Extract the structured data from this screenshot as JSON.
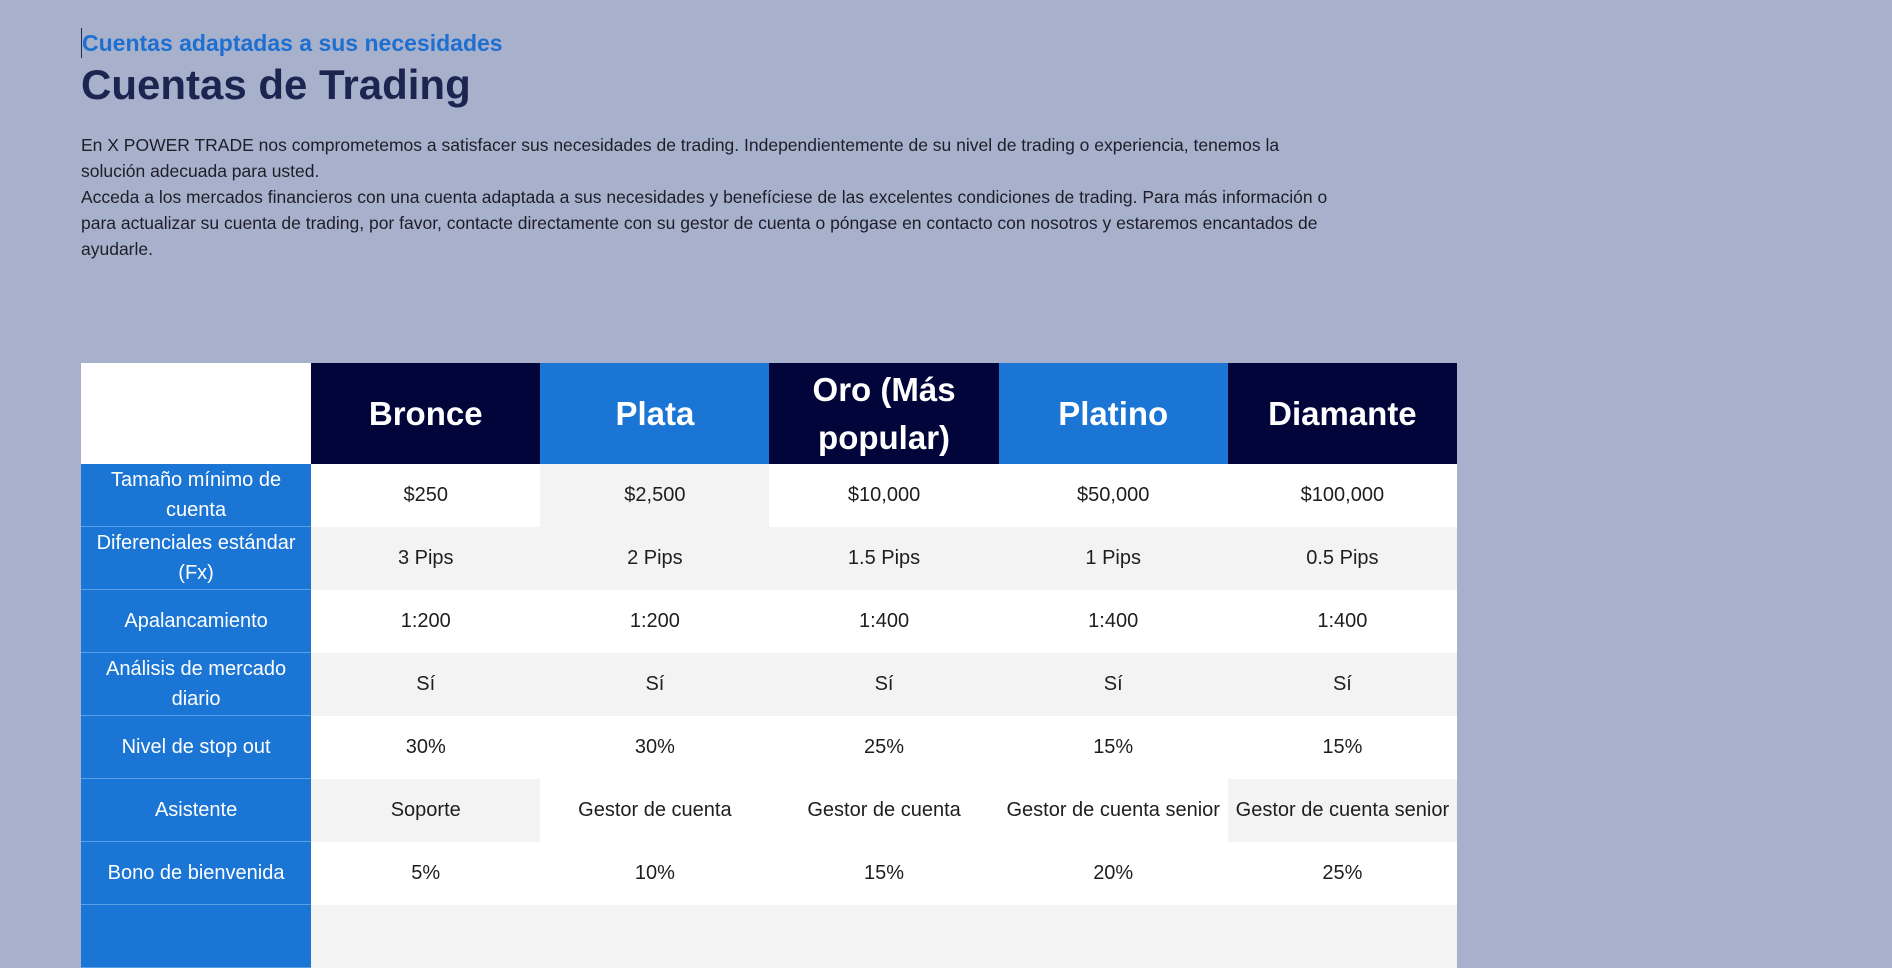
{
  "header": {
    "subtitle": "Cuentas adaptadas a sus necesidades",
    "title": "Cuentas de Trading",
    "paragraph1": "En X POWER TRADE nos comprometemos a satisfacer sus necesidades de trading. Independientemente de su nivel de trading o experiencia, tenemos la solución adecuada para usted.",
    "paragraph2": "Acceda a los mercados financieros con una cuenta adaptada a sus necesidades y benefíciese de las excelentes condiciones de trading. Para más información o para actualizar su cuenta de trading, por favor, contacte directamente con su gestor de cuenta o póngase en contacto con nosotros y estaremos encantados de ayudarle."
  },
  "colors": {
    "page_background": "#a7b1cb",
    "accent_blue": "#1b75d4",
    "navy": "#02053a",
    "title": "#1c2550"
  },
  "table": {
    "columns": [
      "Bronce",
      "Plata",
      "Oro (Más popular)",
      "Platino",
      "Diamante"
    ],
    "rows": [
      {
        "label": "Tamaño mínimo de cuenta",
        "values": [
          "$250",
          "$2,500",
          "$10,000",
          "$50,000",
          "$100,000"
        ]
      },
      {
        "label": "Diferenciales estándar (Fx)",
        "values": [
          "3 Pips",
          "2 Pips",
          "1.5 Pips",
          "1 Pips",
          "0.5 Pips"
        ]
      },
      {
        "label": "Apalancamiento",
        "values": [
          "1:200",
          "1:200",
          "1:400",
          "1:400",
          "1:400"
        ]
      },
      {
        "label": "Análisis de mercado diario",
        "values": [
          "Sí",
          "Sí",
          "Sí",
          "Sí",
          "Sí"
        ]
      },
      {
        "label": "Nivel de stop out",
        "values": [
          "30%",
          "30%",
          "25%",
          "15%",
          "15%"
        ]
      },
      {
        "label": "Asistente",
        "values": [
          "Soporte",
          "Gestor de cuenta",
          "Gestor de cuenta",
          "Gestor de cuenta senior",
          "Gestor de cuenta senior"
        ]
      },
      {
        "label": "Bono de bienvenida",
        "values": [
          "5%",
          "10%",
          "15%",
          "20%",
          "25%"
        ]
      },
      {
        "label": "",
        "values": [
          "",
          "",
          "",
          "",
          ""
        ]
      }
    ]
  }
}
